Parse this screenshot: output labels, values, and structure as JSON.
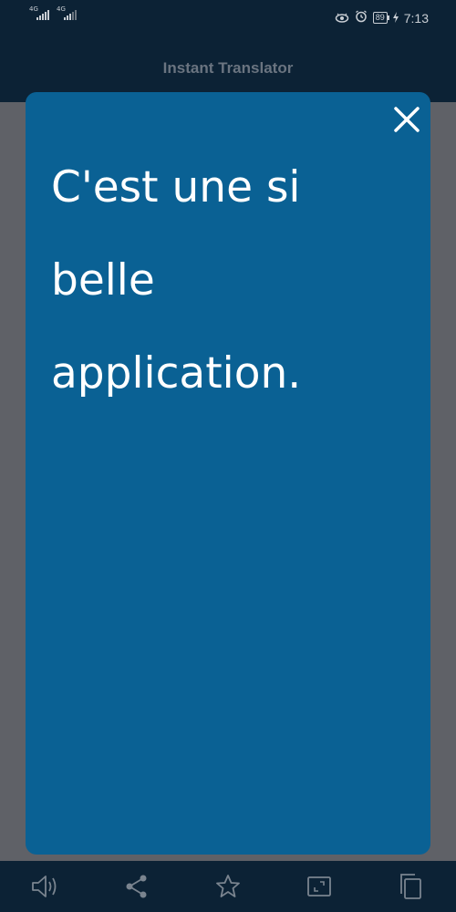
{
  "status_bar": {
    "network_1": "4G",
    "network_2": "4G",
    "battery": "89",
    "time": "7:13"
  },
  "app": {
    "title": "Instant Translator"
  },
  "translation": {
    "text": "C'est une si belle application."
  },
  "toolbar": {
    "items": [
      {
        "icon": "speaker-icon"
      },
      {
        "icon": "share-icon"
      },
      {
        "icon": "star-icon"
      },
      {
        "icon": "fullscreen-icon"
      },
      {
        "icon": "copy-icon"
      }
    ]
  },
  "colors": {
    "bar_background": "#0c2235",
    "card_background": "#0a6194",
    "overlay_background": "#5f6167",
    "icon_color": "#7a848f"
  }
}
